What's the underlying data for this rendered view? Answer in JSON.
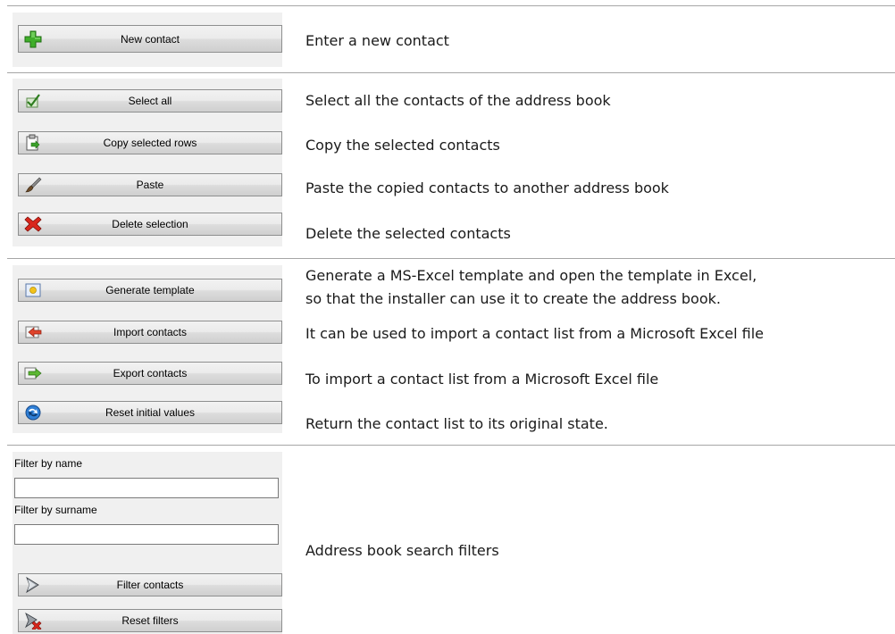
{
  "sections": [
    {
      "buttons": [
        {
          "label": "New contact",
          "icon": "plus-icon"
        }
      ],
      "descriptions": [
        "Enter a new contact"
      ]
    },
    {
      "buttons": [
        {
          "label": "Select all",
          "icon": "checkmark-icon"
        },
        {
          "label": "Copy selected rows",
          "icon": "clipboard-copy-icon"
        },
        {
          "label": "Paste",
          "icon": "paste-brush-icon"
        },
        {
          "label": "Delete selection",
          "icon": "delete-x-icon"
        }
      ],
      "descriptions": [
        "Select all the contacts of the address book",
        "Copy the selected contacts",
        "Paste the copied contacts to another address book",
        "Delete the selected contacts"
      ]
    },
    {
      "buttons": [
        {
          "label": "Generate template",
          "icon": "template-icon"
        },
        {
          "label": "Import contacts",
          "icon": "import-arrow-icon"
        },
        {
          "label": "Export contacts",
          "icon": "export-arrow-icon"
        },
        {
          "label": "Reset initial values",
          "icon": "reset-globe-icon"
        }
      ],
      "descriptions": [
        "Generate a MS-Excel template and open the template in Excel,",
        "so that the installer can use it to create the address book.",
        "It can be used to import a contact list from a Microsoft Excel file",
        "To import a contact list from a Microsoft Excel file",
        "Return the contact list to its original state."
      ]
    },
    {
      "filters": {
        "name_label": "Filter by name",
        "name_value": "",
        "surname_label": "Filter by surname",
        "surname_value": ""
      },
      "buttons": [
        {
          "label": "Filter contacts",
          "icon": "filter-funnel-icon"
        },
        {
          "label": "Reset filters",
          "icon": "reset-filter-icon"
        }
      ],
      "descriptions": [
        "Address book search filters"
      ]
    }
  ]
}
